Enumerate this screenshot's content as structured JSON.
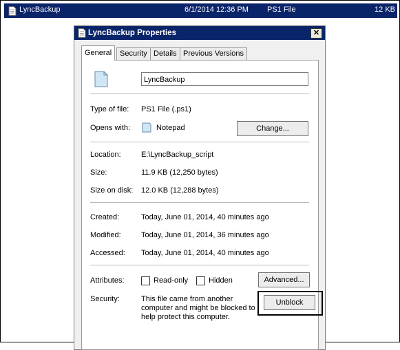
{
  "file_row": {
    "name": "LyncBackup",
    "date": "6/1/2014 12:36 PM",
    "type": "PS1 File",
    "size": "12 KB"
  },
  "dialog": {
    "title": "LyncBackup Properties",
    "close_label": "✕",
    "tabs": [
      "General",
      "Security",
      "Details",
      "Previous Versions"
    ],
    "file_name": "LyncBackup",
    "type_of_file_label": "Type of file:",
    "type_of_file": "PS1 File (.ps1)",
    "opens_with_label": "Opens with:",
    "opens_with": "Notepad",
    "change_button": "Change...",
    "location_label": "Location:",
    "location": "E:\\LyncBackup_script",
    "size_label": "Size:",
    "size": "11.9 KB (12,250 bytes)",
    "size_on_disk_label": "Size on disk:",
    "size_on_disk": "12.0 KB (12,288 bytes)",
    "created_label": "Created:",
    "created": "Today, June 01, 2014, 40 minutes ago",
    "modified_label": "Modified:",
    "modified": "Today, June 01, 2014, 36 minutes ago",
    "accessed_label": "Accessed:",
    "accessed": "Today, June 01, 2014, 40 minutes ago",
    "attributes_label": "Attributes:",
    "readonly_label": "Read-only",
    "hidden_label": "Hidden",
    "advanced_button": "Advanced...",
    "security_label": "Security:",
    "security_line1": "This file came from another",
    "security_line2": "computer and might be blocked to",
    "security_line3": "help protect this computer.",
    "unblock_button": "Unblock"
  },
  "icons": {
    "file": "document-icon",
    "notepad": "notepad-icon"
  }
}
